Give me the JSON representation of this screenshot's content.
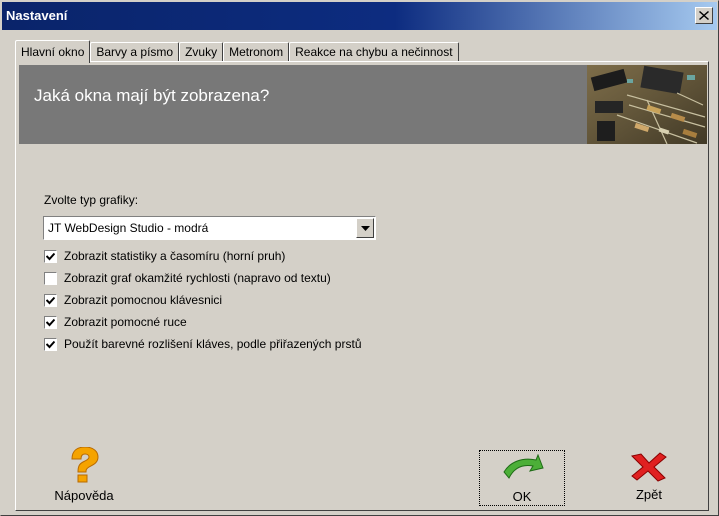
{
  "window": {
    "title": "Nastavení"
  },
  "tabs": [
    {
      "label": "Hlavní okno"
    },
    {
      "label": "Barvy a písmo"
    },
    {
      "label": "Zvuky"
    },
    {
      "label": "Metronom"
    },
    {
      "label": "Reakce na chybu a nečinnost"
    }
  ],
  "banner": {
    "title": "Jaká okna mají být zobrazena?"
  },
  "grafika": {
    "label": "Zvolte typ grafiky:",
    "selected": "JT WebDesign Studio - modrá"
  },
  "checkboxes": [
    {
      "label": "Zobrazit statistiky a časomíru (horní pruh)",
      "checked": true
    },
    {
      "label": "Zobrazit graf okamžité rychlosti (napravo od textu)",
      "checked": false
    },
    {
      "label": "Zobrazit pomocnou klávesnici",
      "checked": true
    },
    {
      "label": "Zobrazit pomocné ruce",
      "checked": true
    },
    {
      "label": "Použít barevné rozlišení kláves, podle přiřazených prstů",
      "checked": true
    }
  ],
  "buttons": {
    "help": {
      "label": "Nápověda",
      "icon": "question-icon"
    },
    "ok": {
      "label": "OK",
      "icon": "check-arrow-icon"
    },
    "back": {
      "label": "Zpět",
      "icon": "red-x-icon"
    }
  }
}
